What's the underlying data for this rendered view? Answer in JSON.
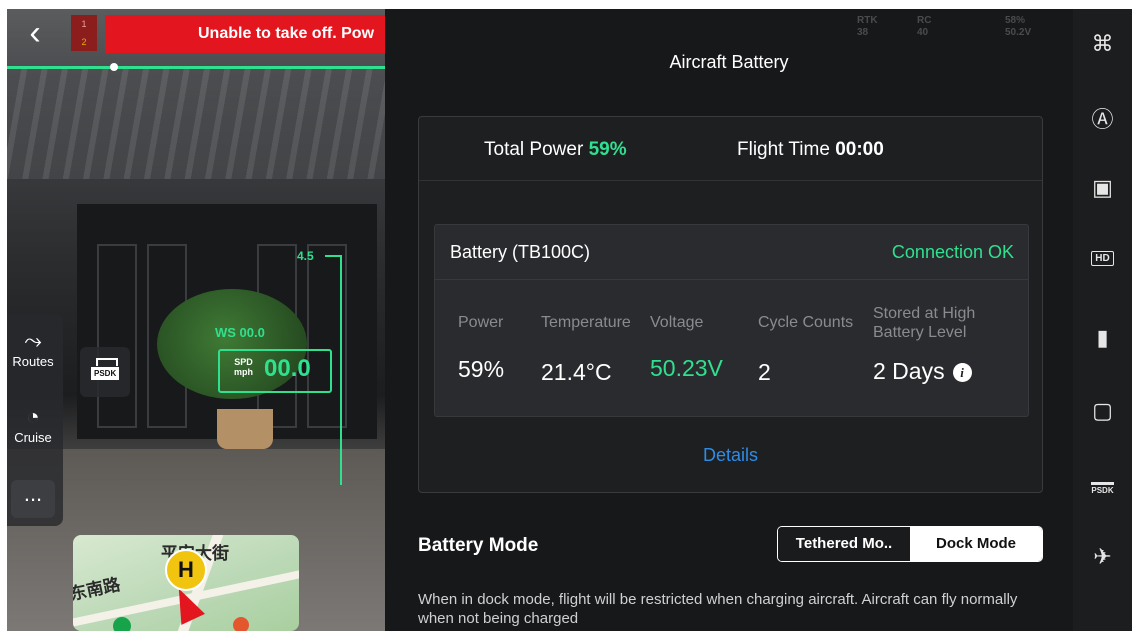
{
  "camera": {
    "warning_text": "Unable to take off. Pow",
    "rec_badge": [
      "1",
      "2"
    ],
    "hud": {
      "altitude_tick": "4.5",
      "wind_speed": "WS 00.0",
      "speed_unit_top": "SPD",
      "speed_unit_bottom": "mph",
      "speed_value": "00.0"
    },
    "rail": {
      "routes_label": "Routes",
      "cruise_label": "Cruise",
      "more_label": "..."
    },
    "psdk_label": "PSDK",
    "minimap": {
      "street_top": "平安大街",
      "street_left": "东南路",
      "home_marker": "H"
    }
  },
  "top_status": {
    "rtk_label": "RTK",
    "rtk_value": "38",
    "rc_label": "RC",
    "rc_value": "40",
    "battery_pct": "58%",
    "battery_volt": "50.2V"
  },
  "panel": {
    "title": "Aircraft Battery",
    "total_power_label": "Total Power",
    "total_power_value": "59%",
    "flight_time_label": "Flight Time",
    "flight_time_value": "00:00",
    "battery": {
      "name": "Battery (TB100C)",
      "connection": "Connection OK",
      "columns": {
        "power_label": "Power",
        "temperature_label": "Temperature",
        "voltage_label": "Voltage",
        "cycle_label": "Cycle Counts",
        "stored_label_1": "Stored at High",
        "stored_label_2": "Battery Level"
      },
      "values": {
        "power": "59%",
        "temperature": "21.4°C",
        "voltage": "50.23V",
        "cycles": "2",
        "stored_days": "2 Days"
      }
    },
    "details_link": "Details",
    "battery_mode": {
      "title": "Battery Mode",
      "options": [
        "Tethered Mo..",
        "Dock Mode"
      ],
      "selected": "Dock Mode",
      "description": "When in dock mode, flight will be restricted when charging aircraft. Aircraft can fly normally when not being charged"
    }
  },
  "toolbar": {
    "hd_label": "HD",
    "psdk_label": "PSDK"
  },
  "colors": {
    "accent_green": "#2fe08f",
    "warning_red": "#e3161f",
    "link_blue": "#2e8ce6"
  }
}
